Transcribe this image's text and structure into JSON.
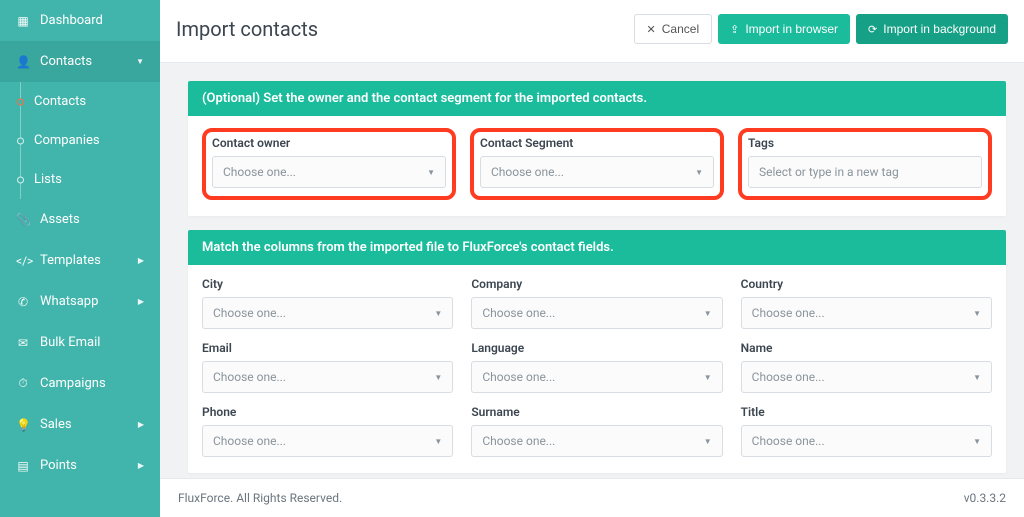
{
  "sidebar": {
    "items": [
      {
        "icon": "▦",
        "label": "Dashboard",
        "expand": false
      },
      {
        "icon": "👤",
        "label": "Contacts",
        "expand": true,
        "children": [
          {
            "label": "Contacts",
            "active": true
          },
          {
            "label": "Companies",
            "active": false
          },
          {
            "label": "Lists",
            "active": false
          }
        ]
      },
      {
        "icon": "📎",
        "label": "Assets",
        "expand": false
      },
      {
        "icon": "</>",
        "label": "Templates",
        "expand": true
      },
      {
        "icon": "✆",
        "label": "Whatsapp",
        "expand": true
      },
      {
        "icon": "✉",
        "label": "Bulk Email",
        "expand": false
      },
      {
        "icon": "⏱",
        "label": "Campaigns",
        "expand": false
      },
      {
        "icon": "💡",
        "label": "Sales",
        "expand": true
      },
      {
        "icon": "▤",
        "label": "Points",
        "expand": true
      }
    ]
  },
  "header": {
    "title": "Import contacts",
    "cancel_label": "Cancel",
    "import_browser_label": "Import in browser",
    "import_background_label": "Import in background"
  },
  "panel_owner": {
    "title": "(Optional) Set the owner and the contact segment for the imported contacts.",
    "fields": {
      "owner": {
        "label": "Contact owner",
        "placeholder": "Choose one..."
      },
      "segment": {
        "label": "Contact Segment",
        "placeholder": "Choose one..."
      },
      "tags": {
        "label": "Tags",
        "placeholder": "Select or type in a new tag"
      }
    }
  },
  "panel_map": {
    "title": "Match the columns from the imported file to FluxForce's contact fields.",
    "placeholder": "Choose one...",
    "fields": [
      {
        "label": "City"
      },
      {
        "label": "Company"
      },
      {
        "label": "Country"
      },
      {
        "label": "Email"
      },
      {
        "label": "Language"
      },
      {
        "label": "Name"
      },
      {
        "label": "Phone"
      },
      {
        "label": "Surname"
      },
      {
        "label": "Title"
      }
    ]
  },
  "footer": {
    "copyright": "FluxForce. All Rights Reserved.",
    "version": "v0.3.3.2"
  }
}
